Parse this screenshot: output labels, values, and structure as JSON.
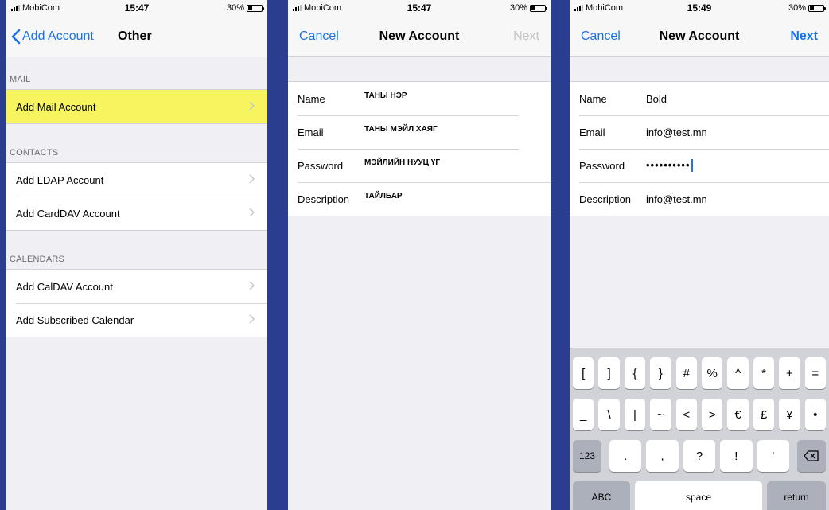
{
  "screens": [
    {
      "status": {
        "carrier": "MobiCom",
        "time": "15:47",
        "battery": "30%",
        "battery_level": 0.3
      },
      "nav": {
        "back_label": "Add Account",
        "title": "Other"
      },
      "sections": [
        {
          "header": "MAIL",
          "items": [
            "Add Mail Account"
          ]
        },
        {
          "header": "CONTACTS",
          "items": [
            "Add LDAP Account",
            "Add CardDAV Account"
          ]
        },
        {
          "header": "CALENDARS",
          "items": [
            "Add CalDAV Account",
            "Add Subscribed Calendar"
          ]
        }
      ]
    },
    {
      "status": {
        "carrier": "MobiCom",
        "time": "15:47",
        "battery": "30%",
        "battery_level": 0.3
      },
      "nav": {
        "cancel": "Cancel",
        "title": "New Account",
        "next": "Next"
      },
      "fields": [
        {
          "label": "Name",
          "value": "ТАНЫ НЭР"
        },
        {
          "label": "Email",
          "value": "ТАНЫ МЭЙЛ ХАЯГ"
        },
        {
          "label": "Password",
          "value": "МЭЙЛИЙН НУУЦ ҮГ"
        },
        {
          "label": "Description",
          "value": "ТАЙЛБАР"
        }
      ]
    },
    {
      "status": {
        "carrier": "MobiCom",
        "time": "15:49",
        "battery": "30%",
        "battery_level": 0.3
      },
      "nav": {
        "cancel": "Cancel",
        "title": "New Account",
        "next": "Next"
      },
      "fields": [
        {
          "label": "Name",
          "value": "Bold"
        },
        {
          "label": "Email",
          "value": "info@test.mn"
        },
        {
          "label": "Password",
          "value": "••••••••••"
        },
        {
          "label": "Description",
          "value": "info@test.mn"
        }
      ],
      "keyboard": {
        "row1": [
          "[",
          "]",
          "{",
          "}",
          "#",
          "%",
          "^",
          "*",
          "+",
          "="
        ],
        "row2": [
          "_",
          "\\",
          "|",
          "~",
          "<",
          ">",
          "€",
          "£",
          "¥",
          "•"
        ],
        "row3": {
          "mode": "123",
          "keys": [
            ".",
            ",",
            "?",
            "!",
            "'"
          ]
        },
        "row4": {
          "abc": "ABC",
          "space": "space",
          "return": "return"
        }
      }
    }
  ],
  "colors": {
    "accent": "#1a73e8",
    "highlight": "#f6f55f",
    "background": "#2b3d8f"
  }
}
